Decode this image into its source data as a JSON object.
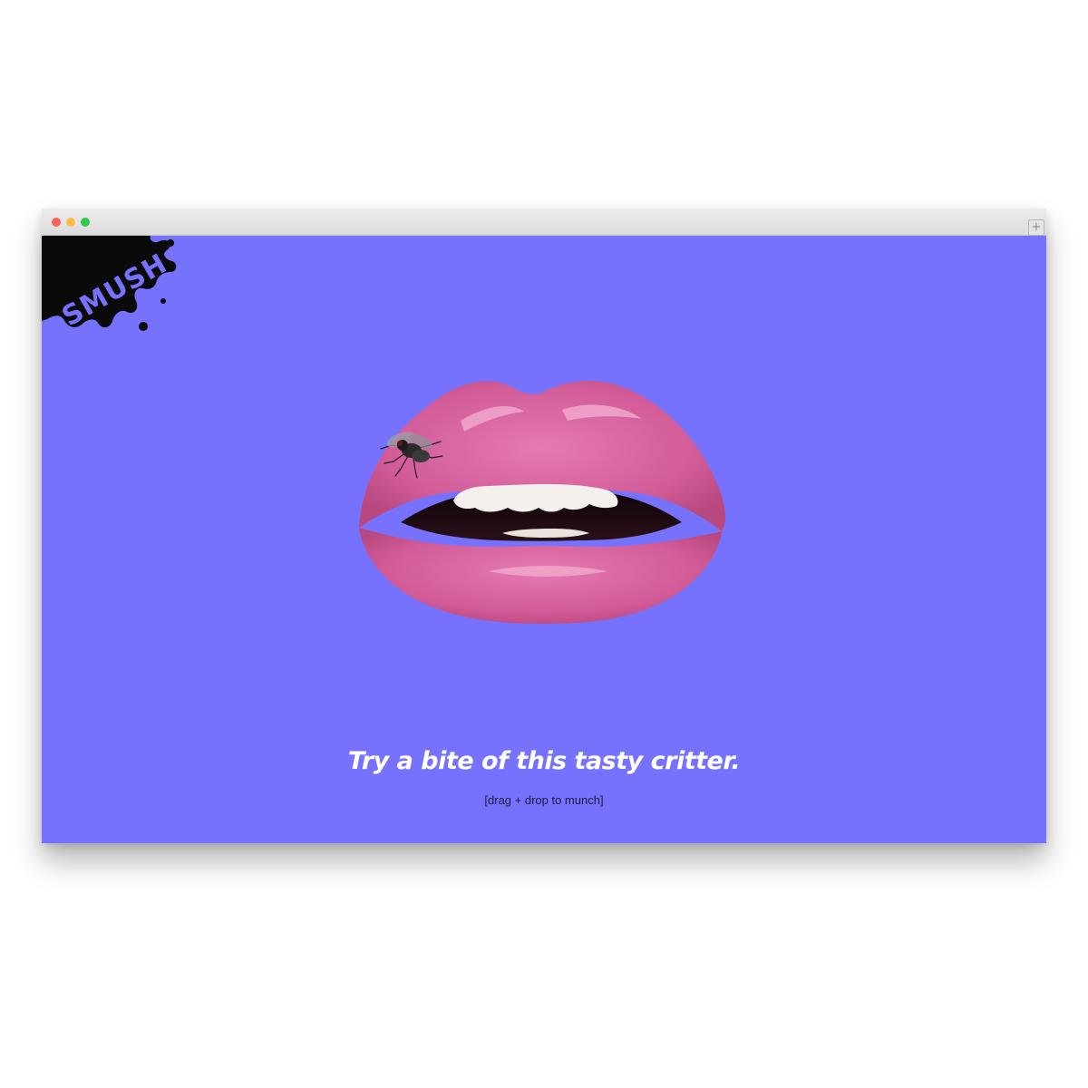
{
  "window": {
    "controls": [
      "close",
      "minimize",
      "zoom"
    ],
    "new_tab_symbol": "+"
  },
  "colors": {
    "background": "#7772fe",
    "lips": "#d9659f",
    "logo_splat": "#0a0a0a",
    "logo_text": "#7772fe",
    "close": "#fc605b",
    "minimize": "#fdbc40",
    "zoom": "#34c84a"
  },
  "logo": {
    "text": "SMUSH",
    "icon": "ink-splat-icon"
  },
  "hero": {
    "lips_icon": "lips-image",
    "critter_icon": "fly-icon"
  },
  "headline": "Try a bite of this tasty critter.",
  "hint": "[drag + drop to munch]"
}
